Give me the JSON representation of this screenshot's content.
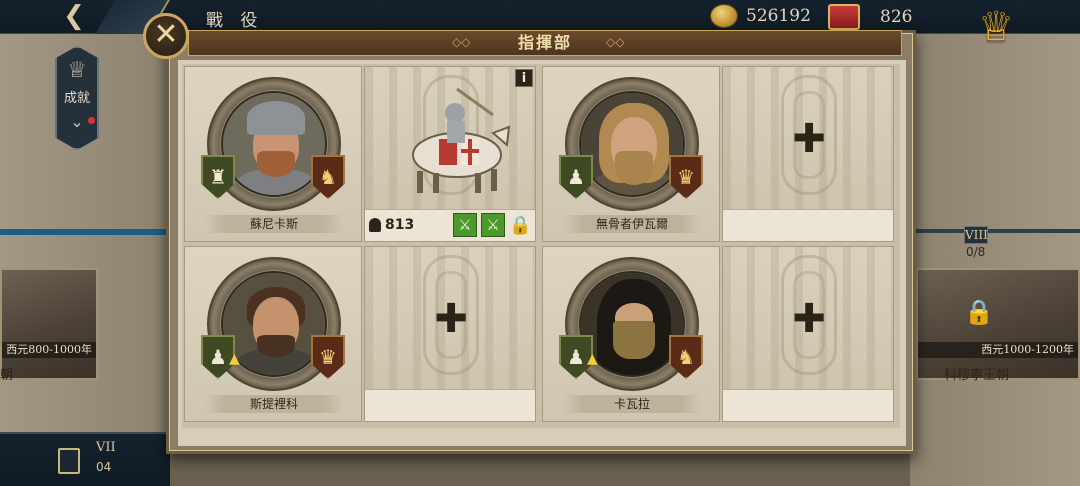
{
  "header": {
    "title": "戰 役",
    "gold": "526192",
    "tickets": "826"
  },
  "left_panel": {
    "achievements_label": "成就",
    "era_caption": "西元800-1000年",
    "era_name": "朝"
  },
  "right_panel": {
    "chapter_badge": "VIII",
    "chapter_progress": "0/8",
    "era_caption": "西元1000-1200年",
    "era_name": "科穆寧王朝"
  },
  "save_slot": {
    "roman": "VII",
    "count": "04"
  },
  "modal": {
    "title": "指揮部",
    "commanders": [
      {
        "name": "蘇尼卡斯",
        "left_shield": "tower",
        "right_shield": "horse",
        "upgrade_arrow": false
      },
      {
        "name": "無骨者伊瓦爾",
        "left_shield": "pawn",
        "right_shield": "crown",
        "upgrade_arrow": false
      },
      {
        "name": "斯提裡科",
        "left_shield": "pawn",
        "right_shield": "crown",
        "upgrade_arrow": true
      },
      {
        "name": "卡瓦拉",
        "left_shield": "pawn",
        "right_shield": "horse",
        "upgrade_arrow": true
      }
    ],
    "unit_slot": {
      "strength": "813",
      "info_label": "i"
    }
  },
  "icons": {
    "close": "close-icon",
    "back": "back-arrow-icon",
    "add": "plus-icon",
    "lock": "lock-icon"
  },
  "colors": {
    "title_gold": "#f2dfae",
    "skill_green": "#4d9a2c",
    "accent_blue": "#1d5c8a"
  }
}
